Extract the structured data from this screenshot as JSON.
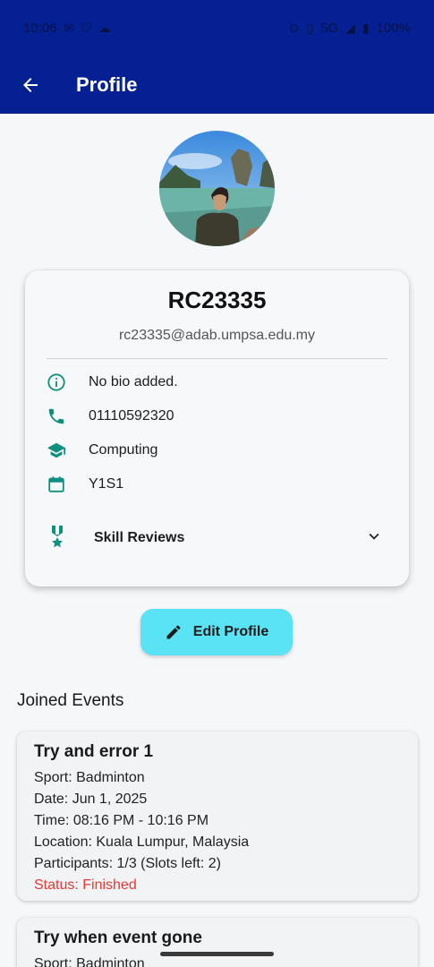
{
  "status_bar": {
    "time": "10:06",
    "network": "5G",
    "battery": "100%"
  },
  "app_bar": {
    "title": "Profile"
  },
  "profile": {
    "username": "RC23335",
    "email": "rc23335@adab.umpsa.edu.my",
    "bio": "No bio added.",
    "phone": "01110592320",
    "faculty": "Computing",
    "year": "Y1S1",
    "skill_reviews_label": "Skill Reviews"
  },
  "edit_button": {
    "label": "Edit Profile"
  },
  "joined_events": {
    "title": "Joined Events",
    "events": [
      {
        "title": "Try and error 1",
        "sport": "Sport: Badminton",
        "date": "Date: Jun 1, 2025",
        "time": "Time: 08:16 PM - 10:16 PM",
        "location": "Location: Kuala Lumpur, Malaysia",
        "participants": "Participants: 1/3 (Slots left: 2)",
        "status": "Status: Finished"
      },
      {
        "title": "Try when event gone",
        "sport": "Sport: Badminton"
      }
    ]
  },
  "colors": {
    "app_bar": "#052093",
    "accent_teal": "#0f8f80",
    "edit_button": "#5ae2f5",
    "status_finished": "#e53935"
  }
}
